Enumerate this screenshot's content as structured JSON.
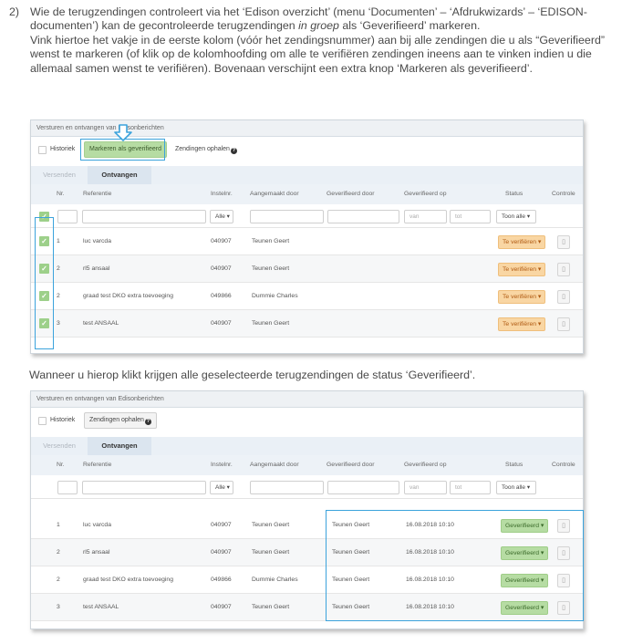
{
  "instructions": {
    "number": "2)",
    "p1_a": "Wie de terugzendingen controleert via het ‘Edison overzicht’ (menu ‘Documenten’ – ‘Afdrukwizards’ – ‘EDISON-documenten’) kan de gecontroleerde terugzendingen ",
    "p1_em": "in groep",
    "p1_b": " als ‘Geverifieerd’ markeren.",
    "p2": "Vink hiertoe het vakje in de eerste kolom (vóór het zendingsnummer) aan bij alle zendingen die u als “Geverifieerd” wenst te markeren (of klik op de kolomhoofding om alle te verifiëren zendingen ineens aan te vinken indien u die allemaal samen wenst te verifiëren). Bovenaan verschijnt een extra knop ‘Markeren als geverifieerd’.",
    "middle": "Wanneer u hierop klikt krijgen alle geselecteerde terugzendingen de status ‘Geverifieerd’."
  },
  "panel_title": "Versturen en ontvangen van Edisonberichten",
  "toolbar": {
    "historiek": "Historiek",
    "markeren": "Markeren als geverifieerd",
    "ophalen": "Zendingen ophalen"
  },
  "tabs": {
    "versenden": "Versenden",
    "ontvangen": "Ontvangen"
  },
  "columns": {
    "nr": "Nr.",
    "referentie": "Referentie",
    "instelnr": "Instelnr.",
    "aangemaakt": "Aangemaakt door",
    "geverifieerd_door": "Geverifieerd door",
    "geverifieerd_op": "Geverifieerd op",
    "status": "Status",
    "controle": "Controle"
  },
  "filters": {
    "alle": "Alle",
    "van": "van",
    "tot": "tot",
    "toon_alle": "Toon alle"
  },
  "screen1_rows": [
    {
      "nr": "1",
      "ref": "luc varcda",
      "inst": "040907",
      "by": "Teunen Geert",
      "status": "Te verifiëren"
    },
    {
      "nr": "2",
      "ref": "rl5 ansaal",
      "inst": "040907",
      "by": "Teunen Geert",
      "status": "Te verifiëren"
    },
    {
      "nr": "2",
      "ref": "graad test DKO extra toevoeging",
      "inst": "049866",
      "by": "Dummie Charles",
      "status": "Te verifiëren"
    },
    {
      "nr": "3",
      "ref": "test ANSAAL",
      "inst": "040907",
      "by": "Teunen Geert",
      "status": "Te verifiëren"
    }
  ],
  "screen2_rows": [
    {
      "nr": "1",
      "ref": "luc varcda",
      "inst": "040907",
      "by": "Teunen Geert",
      "verified_by": "Teunen Geert",
      "verified_on": "16.08.2018 10:10",
      "status": "Geverifieerd"
    },
    {
      "nr": "2",
      "ref": "rl5 ansaal",
      "inst": "040907",
      "by": "Teunen Geert",
      "verified_by": "Teunen Geert",
      "verified_on": "16.08.2018 10:10",
      "status": "Geverifieerd"
    },
    {
      "nr": "2",
      "ref": "graad test DKO extra toevoeging",
      "inst": "049866",
      "by": "Dummie Charles",
      "verified_by": "Teunen Geert",
      "verified_on": "16.08.2018 10:10",
      "status": "Geverifieerd"
    },
    {
      "nr": "3",
      "ref": "test ANSAAL",
      "inst": "040907",
      "by": "Teunen Geert",
      "verified_by": "Teunen Geert",
      "verified_on": "16.08.2018 10:10",
      "status": "Geverifieerd"
    }
  ],
  "colors": {
    "highlight": "#3ba3dc",
    "verify_orange": "#f9d6a3",
    "verified_green": "#b6dca3"
  },
  "icons": {
    "check": "checkmark-icon",
    "doc": "document-icon",
    "question": "question-circle-icon",
    "arrow": "arrow-down-icon"
  }
}
